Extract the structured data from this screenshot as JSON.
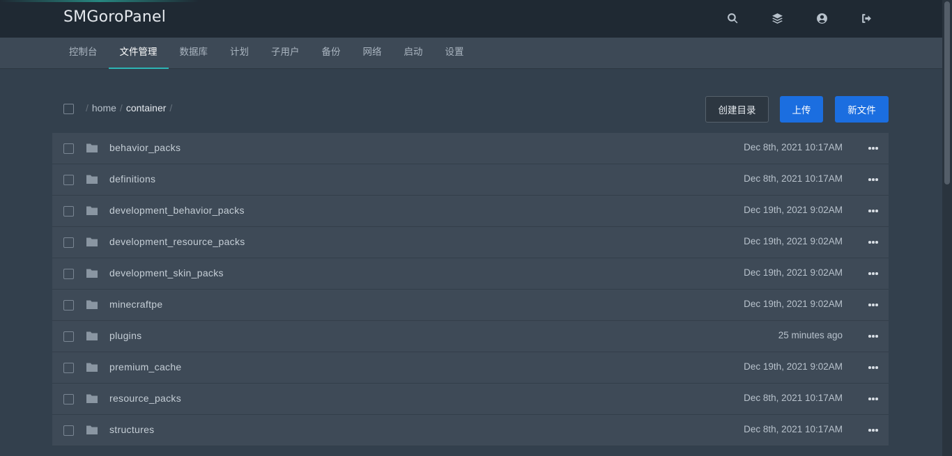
{
  "app": {
    "title": "SMGoroPanel"
  },
  "topbar": {
    "icons": [
      "search-icon",
      "layers-icon",
      "user-circle-icon",
      "sign-out-icon"
    ]
  },
  "nav": {
    "tabs": [
      {
        "label": "控制台"
      },
      {
        "label": "文件管理",
        "active": true
      },
      {
        "label": "数据库"
      },
      {
        "label": "计划"
      },
      {
        "label": "子用户"
      },
      {
        "label": "备份"
      },
      {
        "label": "网络"
      },
      {
        "label": "启动"
      },
      {
        "label": "设置"
      }
    ]
  },
  "breadcrumb": {
    "separator": "/",
    "items": [
      "home",
      "container"
    ]
  },
  "actions": {
    "mkdir": "创建目录",
    "upload": "上传",
    "new_file": "新文件"
  },
  "files": [
    {
      "name": "behavior_packs",
      "modified": "Dec 8th, 2021 10:17AM"
    },
    {
      "name": "definitions",
      "modified": "Dec 8th, 2021 10:17AM"
    },
    {
      "name": "development_behavior_packs",
      "modified": "Dec 19th, 2021 9:02AM"
    },
    {
      "name": "development_resource_packs",
      "modified": "Dec 19th, 2021 9:02AM"
    },
    {
      "name": "development_skin_packs",
      "modified": "Dec 19th, 2021 9:02AM"
    },
    {
      "name": "minecraftpe",
      "modified": "Dec 19th, 2021 9:02AM"
    },
    {
      "name": "plugins",
      "modified": "25 minutes ago"
    },
    {
      "name": "premium_cache",
      "modified": "Dec 19th, 2021 9:02AM"
    },
    {
      "name": "resource_packs",
      "modified": "Dec 8th, 2021 10:17AM"
    },
    {
      "name": "structures",
      "modified": "Dec 8th, 2021 10:17AM"
    }
  ],
  "colors": {
    "accent": "#2cb5b5",
    "primary_button": "#1b6ee0",
    "topbar_bg": "#1f2933",
    "page_bg": "#33404d",
    "row_bg": "#3e4a57"
  }
}
